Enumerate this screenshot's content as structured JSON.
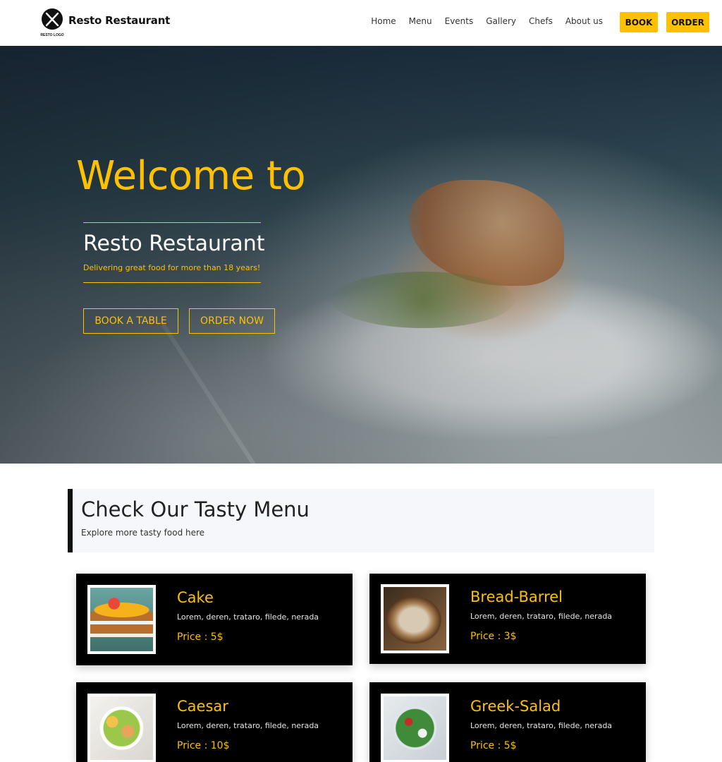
{
  "navbar": {
    "brand": "Resto Restaurant",
    "logo_text": "RESTO LOGO",
    "links": [
      "Home",
      "Menu",
      "Events",
      "Gallery",
      "Chefs",
      "About us"
    ],
    "book_label": "BOOK",
    "order_label": "ORDER"
  },
  "hero": {
    "title": "Welcome to",
    "name": "Resto Restaurant",
    "tagline": "Delivering great food for more than 18 years!",
    "book_button": "BOOK A TABLE",
    "order_button": "ORDER NOW"
  },
  "menu": {
    "title": "Check Our Tasty Menu",
    "subtitle": "Explore more tasty food here",
    "items": [
      {
        "name": "Cake",
        "description": "Lorem, deren, trataro, filede, nerada",
        "price": "Price : 5$"
      },
      {
        "name": "Bread-Barrel",
        "description": "Lorem, deren, trataro, filede, nerada",
        "price": "Price : 3$"
      },
      {
        "name": "Caesar",
        "description": "Lorem, deren, trataro, filede, nerada",
        "price": "Price : 10$"
      },
      {
        "name": "Greek-Salad",
        "description": "Lorem, deren, trataro, filede, nerada",
        "price": "Price : 5$"
      }
    ]
  },
  "colors": {
    "accent": "#fdc100",
    "card_bg": "#000000",
    "header_bg": "#ffffff"
  }
}
